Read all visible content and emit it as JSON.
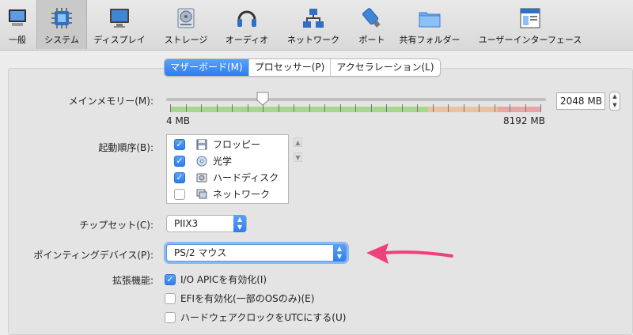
{
  "toolbar": {
    "items": [
      {
        "label": "一般",
        "icon": "general-icon"
      },
      {
        "label": "システム",
        "icon": "system-icon",
        "active": true
      },
      {
        "label": "ディスプレイ",
        "icon": "display-icon"
      },
      {
        "label": "ストレージ",
        "icon": "storage-icon"
      },
      {
        "label": "オーディオ",
        "icon": "audio-icon"
      },
      {
        "label": "ネットワーク",
        "icon": "network-icon"
      },
      {
        "label": "ポート",
        "icon": "port-icon"
      },
      {
        "label": "共有フォルダー",
        "icon": "shared-folder-icon"
      },
      {
        "label": "ユーザーインターフェース",
        "icon": "user-interface-icon"
      }
    ]
  },
  "tabs": [
    {
      "label": "マザーボード(M)",
      "selected": true
    },
    {
      "label": "プロセッサー(P)",
      "selected": false
    },
    {
      "label": "アクセラレーション(L)",
      "selected": false
    }
  ],
  "memory": {
    "label": "メインメモリー(M):",
    "value": "2048 MB",
    "min_label": "4 MB",
    "max_label": "8192 MB",
    "value_mb": 2048,
    "min_mb": 4,
    "max_mb": 8192
  },
  "boot_order": {
    "label": "起動順序(B):",
    "items": [
      {
        "label": "フロッピー",
        "checked": true,
        "icon": "floppy-icon"
      },
      {
        "label": "光学",
        "checked": true,
        "icon": "optical-disc-icon"
      },
      {
        "label": "ハードディスク",
        "checked": true,
        "icon": "hard-disk-icon"
      },
      {
        "label": "ネットワーク",
        "checked": false,
        "icon": "network-boot-icon"
      }
    ]
  },
  "chipset": {
    "label": "チップセット(C):",
    "value": "PIIX3"
  },
  "pointing": {
    "label": "ポインティングデバイス(P):",
    "value": "PS/2 マウス"
  },
  "features": {
    "label": "拡張機能:",
    "items": [
      {
        "label": "I/O APICを有効化(I)",
        "checked": true
      },
      {
        "label": "EFIを有効化(一部のOSのみ)(E)",
        "checked": false
      },
      {
        "label": "ハードウェアクロックをUTCにする(U)",
        "checked": false
      }
    ]
  },
  "colors": {
    "accent": "#2f7cf0",
    "annotation_arrow": "#f0407a"
  }
}
